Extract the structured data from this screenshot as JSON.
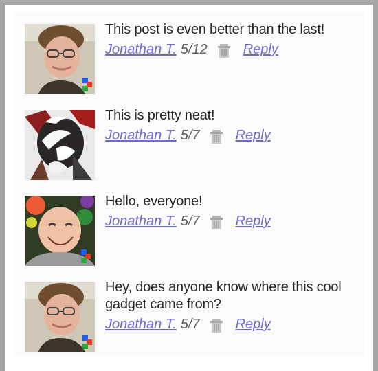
{
  "colors": {
    "link": "#6d6ad0",
    "text": "#262626",
    "date": "#616161",
    "border": "#a7a7a7"
  },
  "comments": [
    {
      "text": "This post is even better than the last!",
      "author": "Jonathan T.",
      "date": "5/12",
      "reply": "Reply",
      "delete_icon": "trash-icon",
      "avatar": "avatar-glasses"
    },
    {
      "text": "This is pretty neat!",
      "author": "Jonathan T.",
      "date": "5/7",
      "reply": "Reply",
      "delete_icon": "trash-icon",
      "avatar": "avatar-abstract"
    },
    {
      "text": "Hello, everyone!",
      "author": "Jonathan T.",
      "date": "5/7",
      "reply": "Reply",
      "delete_icon": "trash-icon",
      "avatar": "avatar-smiling"
    },
    {
      "text": "Hey, does anyone know where this cool gadget came from?",
      "author": "Jonathan T.",
      "date": "5/7",
      "reply": "Reply",
      "delete_icon": "trash-icon",
      "avatar": "avatar-glasses"
    }
  ]
}
